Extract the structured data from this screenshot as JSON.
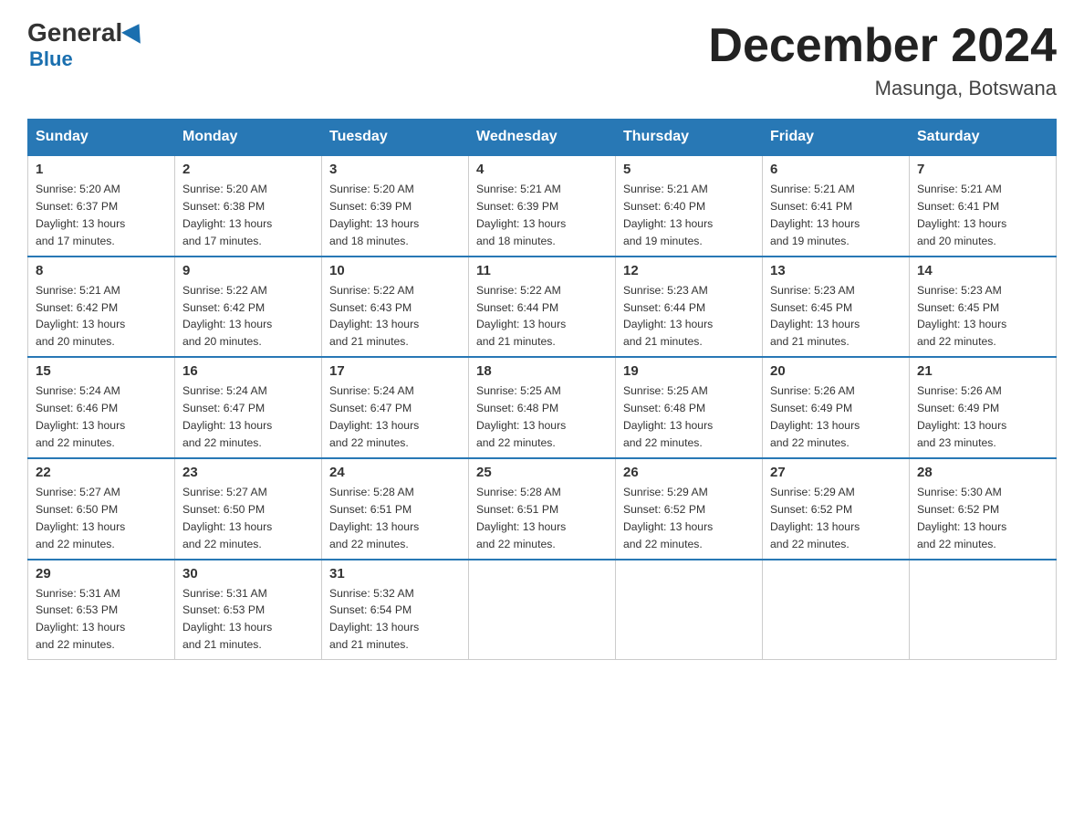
{
  "header": {
    "logo_general": "General",
    "logo_blue": "Blue",
    "month_title": "December 2024",
    "location": "Masunga, Botswana"
  },
  "weekdays": [
    "Sunday",
    "Monday",
    "Tuesday",
    "Wednesday",
    "Thursday",
    "Friday",
    "Saturday"
  ],
  "weeks": [
    [
      {
        "day": "1",
        "info": "Sunrise: 5:20 AM\nSunset: 6:37 PM\nDaylight: 13 hours\nand 17 minutes."
      },
      {
        "day": "2",
        "info": "Sunrise: 5:20 AM\nSunset: 6:38 PM\nDaylight: 13 hours\nand 17 minutes."
      },
      {
        "day": "3",
        "info": "Sunrise: 5:20 AM\nSunset: 6:39 PM\nDaylight: 13 hours\nand 18 minutes."
      },
      {
        "day": "4",
        "info": "Sunrise: 5:21 AM\nSunset: 6:39 PM\nDaylight: 13 hours\nand 18 minutes."
      },
      {
        "day": "5",
        "info": "Sunrise: 5:21 AM\nSunset: 6:40 PM\nDaylight: 13 hours\nand 19 minutes."
      },
      {
        "day": "6",
        "info": "Sunrise: 5:21 AM\nSunset: 6:41 PM\nDaylight: 13 hours\nand 19 minutes."
      },
      {
        "day": "7",
        "info": "Sunrise: 5:21 AM\nSunset: 6:41 PM\nDaylight: 13 hours\nand 20 minutes."
      }
    ],
    [
      {
        "day": "8",
        "info": "Sunrise: 5:21 AM\nSunset: 6:42 PM\nDaylight: 13 hours\nand 20 minutes."
      },
      {
        "day": "9",
        "info": "Sunrise: 5:22 AM\nSunset: 6:42 PM\nDaylight: 13 hours\nand 20 minutes."
      },
      {
        "day": "10",
        "info": "Sunrise: 5:22 AM\nSunset: 6:43 PM\nDaylight: 13 hours\nand 21 minutes."
      },
      {
        "day": "11",
        "info": "Sunrise: 5:22 AM\nSunset: 6:44 PM\nDaylight: 13 hours\nand 21 minutes."
      },
      {
        "day": "12",
        "info": "Sunrise: 5:23 AM\nSunset: 6:44 PM\nDaylight: 13 hours\nand 21 minutes."
      },
      {
        "day": "13",
        "info": "Sunrise: 5:23 AM\nSunset: 6:45 PM\nDaylight: 13 hours\nand 21 minutes."
      },
      {
        "day": "14",
        "info": "Sunrise: 5:23 AM\nSunset: 6:45 PM\nDaylight: 13 hours\nand 22 minutes."
      }
    ],
    [
      {
        "day": "15",
        "info": "Sunrise: 5:24 AM\nSunset: 6:46 PM\nDaylight: 13 hours\nand 22 minutes."
      },
      {
        "day": "16",
        "info": "Sunrise: 5:24 AM\nSunset: 6:47 PM\nDaylight: 13 hours\nand 22 minutes."
      },
      {
        "day": "17",
        "info": "Sunrise: 5:24 AM\nSunset: 6:47 PM\nDaylight: 13 hours\nand 22 minutes."
      },
      {
        "day": "18",
        "info": "Sunrise: 5:25 AM\nSunset: 6:48 PM\nDaylight: 13 hours\nand 22 minutes."
      },
      {
        "day": "19",
        "info": "Sunrise: 5:25 AM\nSunset: 6:48 PM\nDaylight: 13 hours\nand 22 minutes."
      },
      {
        "day": "20",
        "info": "Sunrise: 5:26 AM\nSunset: 6:49 PM\nDaylight: 13 hours\nand 22 minutes."
      },
      {
        "day": "21",
        "info": "Sunrise: 5:26 AM\nSunset: 6:49 PM\nDaylight: 13 hours\nand 23 minutes."
      }
    ],
    [
      {
        "day": "22",
        "info": "Sunrise: 5:27 AM\nSunset: 6:50 PM\nDaylight: 13 hours\nand 22 minutes."
      },
      {
        "day": "23",
        "info": "Sunrise: 5:27 AM\nSunset: 6:50 PM\nDaylight: 13 hours\nand 22 minutes."
      },
      {
        "day": "24",
        "info": "Sunrise: 5:28 AM\nSunset: 6:51 PM\nDaylight: 13 hours\nand 22 minutes."
      },
      {
        "day": "25",
        "info": "Sunrise: 5:28 AM\nSunset: 6:51 PM\nDaylight: 13 hours\nand 22 minutes."
      },
      {
        "day": "26",
        "info": "Sunrise: 5:29 AM\nSunset: 6:52 PM\nDaylight: 13 hours\nand 22 minutes."
      },
      {
        "day": "27",
        "info": "Sunrise: 5:29 AM\nSunset: 6:52 PM\nDaylight: 13 hours\nand 22 minutes."
      },
      {
        "day": "28",
        "info": "Sunrise: 5:30 AM\nSunset: 6:52 PM\nDaylight: 13 hours\nand 22 minutes."
      }
    ],
    [
      {
        "day": "29",
        "info": "Sunrise: 5:31 AM\nSunset: 6:53 PM\nDaylight: 13 hours\nand 22 minutes."
      },
      {
        "day": "30",
        "info": "Sunrise: 5:31 AM\nSunset: 6:53 PM\nDaylight: 13 hours\nand 21 minutes."
      },
      {
        "day": "31",
        "info": "Sunrise: 5:32 AM\nSunset: 6:54 PM\nDaylight: 13 hours\nand 21 minutes."
      },
      {
        "day": "",
        "info": ""
      },
      {
        "day": "",
        "info": ""
      },
      {
        "day": "",
        "info": ""
      },
      {
        "day": "",
        "info": ""
      }
    ]
  ]
}
